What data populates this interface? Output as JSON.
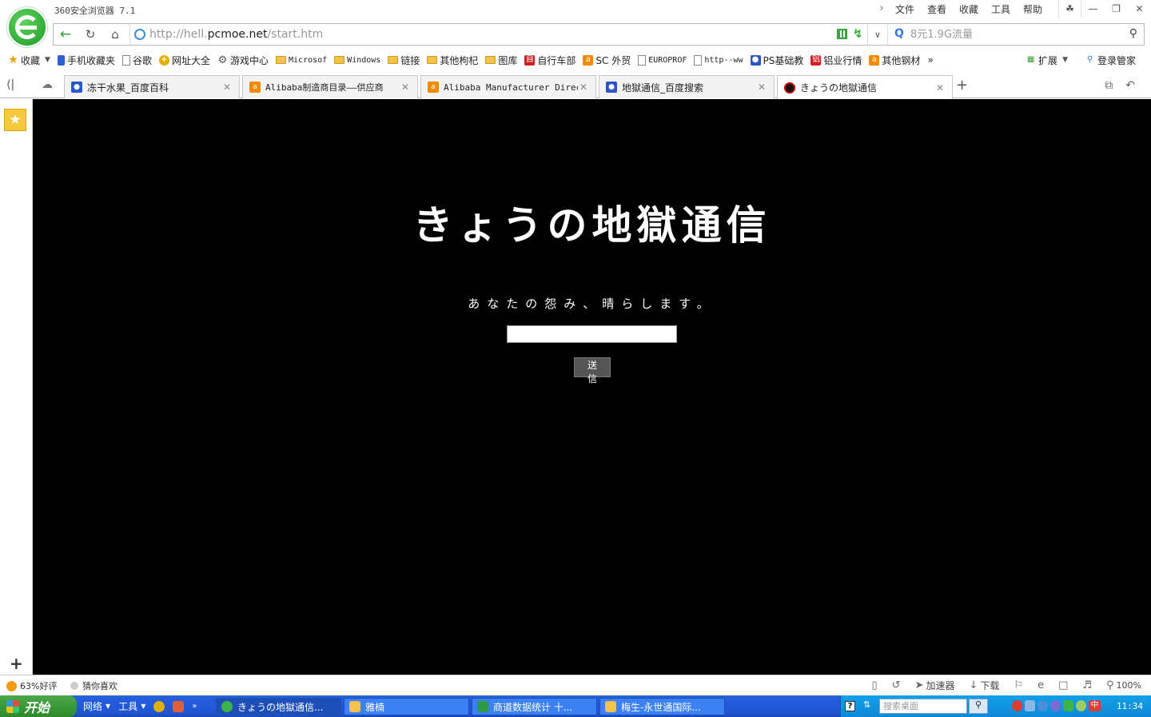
{
  "window": {
    "app_title": "360安全浏览器 7.1",
    "menu": [
      "文件",
      "查看",
      "收藏",
      "工具",
      "帮助"
    ],
    "minimize": "—",
    "maximize": "❐",
    "close": "✕"
  },
  "address_bar": {
    "url_prefix": "http://hell.",
    "url_host": "pcmoe.net",
    "url_path": "/start.htm",
    "search_placeholder": "8元1.9G流量"
  },
  "bookmarks": {
    "favorites_label": "收藏",
    "items": [
      {
        "label": "手机收藏夹",
        "icon": "phone-icon"
      },
      {
        "label": "谷歌",
        "icon": "page-icon"
      },
      {
        "label": "网址大全",
        "icon": "plus-icon"
      },
      {
        "label": "游戏中心",
        "icon": "gamepad-icon"
      },
      {
        "label": "Microsof",
        "icon": "folder-icon"
      },
      {
        "label": "Windows",
        "icon": "folder-icon"
      },
      {
        "label": "链接",
        "icon": "folder-icon"
      },
      {
        "label": "其他枸杞",
        "icon": "folder-icon"
      },
      {
        "label": "图库",
        "icon": "folder-icon"
      },
      {
        "label": "自行车部",
        "icon": "red-icon"
      },
      {
        "label": "SC 外贸",
        "icon": "alibaba-icon"
      },
      {
        "label": "EUROPROF",
        "icon": "page-icon"
      },
      {
        "label": "http--ww",
        "icon": "page-icon"
      },
      {
        "label": "PS基础教",
        "icon": "paw-icon"
      },
      {
        "label": "铝业行情",
        "icon": "red-icon"
      },
      {
        "label": "其他钢材",
        "icon": "alibaba-icon"
      }
    ],
    "more": "»",
    "extensions_label": "扩展",
    "login_label": "登录管家"
  },
  "tabs": [
    {
      "title": "冻干水果_百度百科",
      "icon": "paw-icon"
    },
    {
      "title": "Alibaba制造商目录——供应商",
      "icon": "alibaba-icon"
    },
    {
      "title": "Alibaba Manufacturer Directory",
      "icon": "alibaba-icon"
    },
    {
      "title": "地獄通信_百度搜索",
      "icon": "paw-icon"
    },
    {
      "title": "きょうの地獄通信",
      "icon": "hell-icon"
    }
  ],
  "page": {
    "title": "きょうの地獄通信",
    "subtitle": "あなたの怨み、晴らします。",
    "send_label": "送信",
    "input_value": ""
  },
  "status_bar": {
    "rating": "63%好评",
    "guess": "猜你喜欢",
    "accelerator": "加速器",
    "download": "下载",
    "zoom": "100%"
  },
  "taskbar": {
    "start_label": "开始",
    "network": "网络",
    "tools": "工具",
    "tasks": [
      {
        "label": "きょうの地獄通信...",
        "color": "#3bb34a"
      },
      {
        "label": "雅楠",
        "color": "#f2c24b"
      },
      {
        "label": "商道数据统计 十...",
        "color": "#2e9b43"
      },
      {
        "label": "梅生-永世通国际...",
        "color": "#f2c24b"
      }
    ],
    "desktop_search": "搜索桌面",
    "ime": "中",
    "clock": "11:34"
  }
}
